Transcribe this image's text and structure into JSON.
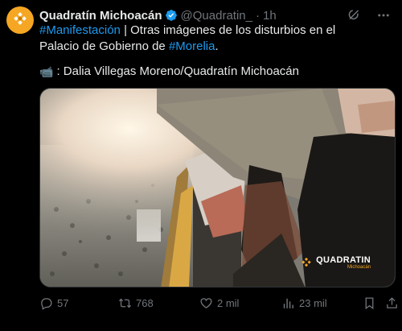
{
  "tweet": {
    "author_name": "Quadratín Michoacán",
    "handle": "@Quadratin_",
    "separator": "·",
    "time": "1h",
    "text_tag1": "#Manifestación",
    "text_mid": " | Otras imágenes de los disturbios en el Palacio de Gobierno de ",
    "text_tag2": "#Morelia",
    "text_end": ".",
    "credit_icon": "📹",
    "credit_text": ": Dalia Villegas Moreno/Quadratín Michoacán",
    "watermark_title": "QUADRATIN",
    "watermark_sub": "Michoacán"
  },
  "actions": {
    "replies": "57",
    "retweets": "768",
    "likes": "2 mil",
    "views": "23 mil"
  },
  "icons": {
    "avatar": "quadratin-logo-icon",
    "verified": "verified-badge-icon",
    "grok": "grok-icon",
    "more": "more-icon",
    "reply": "reply-icon",
    "retweet": "retweet-icon",
    "like": "heart-icon",
    "views": "views-icon",
    "bookmark": "bookmark-icon",
    "share": "share-icon"
  },
  "colors": {
    "background": "#000000",
    "text": "#e7e9ea",
    "muted": "#71767b",
    "link": "#1d9bf0",
    "brand": "#f5a623"
  }
}
